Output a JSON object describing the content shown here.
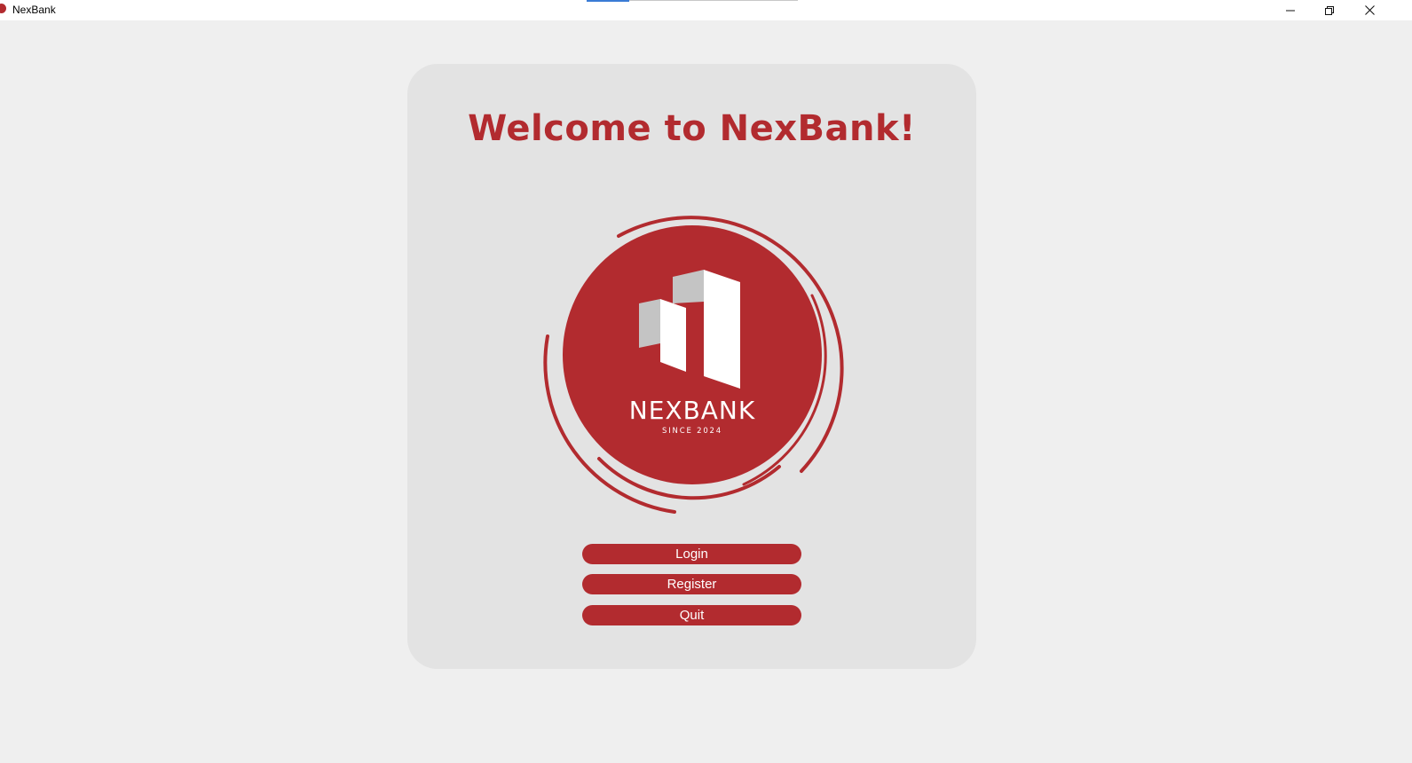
{
  "window": {
    "title": "NexBank",
    "controls": {
      "minimize_icon": "minimize-icon",
      "restore_icon": "restore-icon",
      "close_icon": "close-icon"
    }
  },
  "main": {
    "heading": "Welcome to NexBank!",
    "logo": {
      "name": "NEXBANK",
      "tagline": "SINCE 2024"
    },
    "buttons": {
      "login": "Login",
      "register": "Register",
      "quit": "Quit"
    }
  },
  "colors": {
    "brand": "#b22b2f",
    "background": "#efefef",
    "card": "#e3e3e3",
    "logo_gray": "#c4c4c4"
  }
}
